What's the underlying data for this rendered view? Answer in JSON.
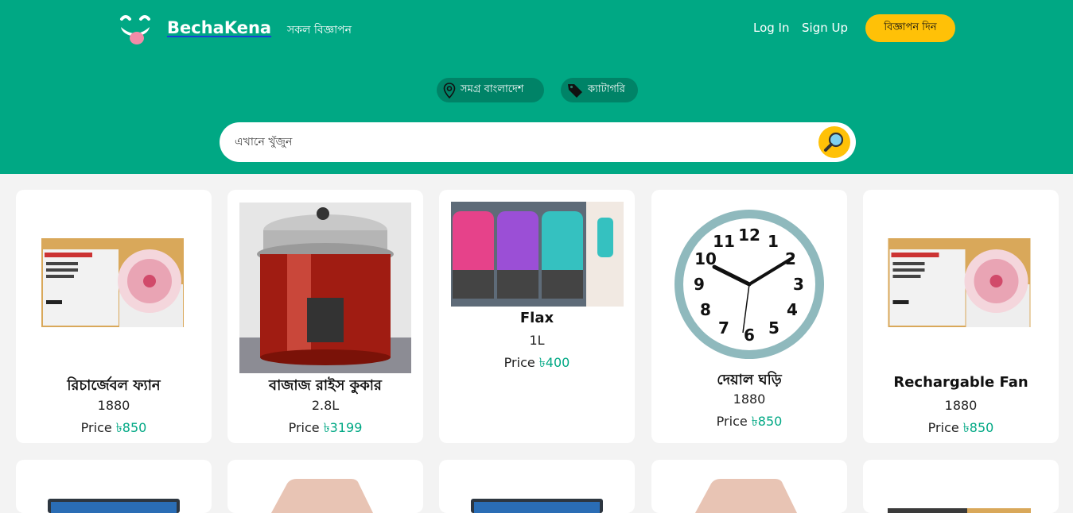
{
  "header": {
    "brand": "BechaKena",
    "all_ads": "সকল বিজ্ঞাপন",
    "login": "Log In",
    "signup": "Sign Up",
    "post_ad": "বিজ্ঞাপন দিন",
    "location": "সমগ্র বাংলাদেশ",
    "category": "ক্যাটাগরি",
    "search_placeholder": "এখানে খুঁজুন"
  },
  "colors": {
    "brand_green": "#00a884",
    "accent_yellow": "#ffc107"
  },
  "products": [
    {
      "title": "রিচার্জেবল ফ্যান",
      "sub": "1880",
      "price_label": "Price",
      "price": "৳850",
      "image": "fan"
    },
    {
      "title": "বাজাজ রাইস কুকার",
      "sub": "2.8L",
      "price_label": "Price",
      "price": "৳3199",
      "image": "rice-cooker"
    },
    {
      "title": "Flax",
      "sub": "1L",
      "price_label": "Price",
      "price": "৳400",
      "image": "flasks"
    },
    {
      "title": "দেয়াল ঘড়ি",
      "sub": "1880",
      "price_label": "Price",
      "price": "৳850",
      "image": "wall-clock"
    },
    {
      "title": "Rechargable Fan",
      "sub": "1880",
      "price_label": "Price",
      "price": "৳850",
      "image": "fan"
    }
  ]
}
